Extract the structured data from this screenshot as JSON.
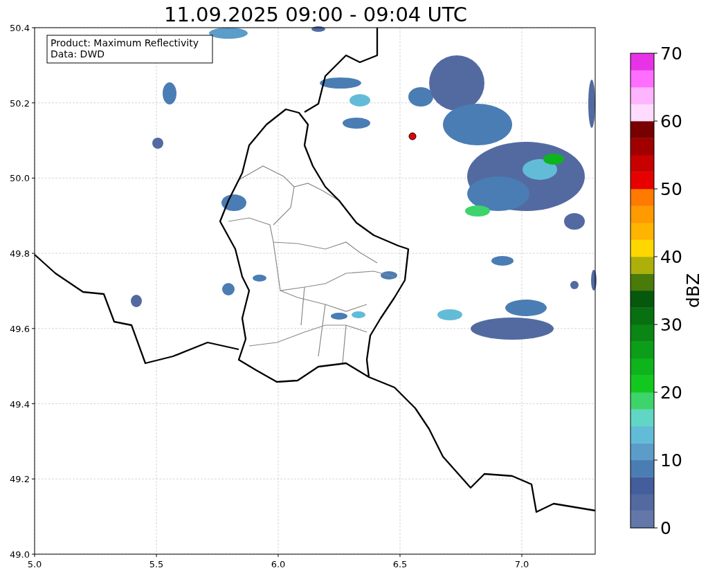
{
  "title": "11.09.2025 09:00 - 09:04 UTC",
  "info_box": [
    "Product: Maximum Reflectivity",
    "Data: DWD"
  ],
  "x_ticks": [
    "5.0",
    "5.5",
    "6.0",
    "6.5",
    "7.0"
  ],
  "y_ticks": [
    "50.4",
    "50.2",
    "50.0",
    "49.8",
    "49.6",
    "49.4",
    "49.2",
    "49.0"
  ],
  "colorbar": {
    "label": "dBZ",
    "ticks": [
      "70",
      "60",
      "50",
      "40",
      "30",
      "20",
      "10",
      "0"
    ],
    "segments": [
      {
        "color": "#6378a8"
      },
      {
        "color": "#536aa1"
      },
      {
        "color": "#435d9d"
      },
      {
        "color": "#4a7db3"
      },
      {
        "color": "#5b9cc9"
      },
      {
        "color": "#62bcd8"
      },
      {
        "color": "#62d6c4"
      },
      {
        "color": "#3dd46c"
      },
      {
        "color": "#12c81e"
      },
      {
        "color": "#0eb41c"
      },
      {
        "color": "#0c9e18"
      },
      {
        "color": "#0a8614"
      },
      {
        "color": "#087010"
      },
      {
        "color": "#06580c"
      },
      {
        "color": "#4a7a0a"
      },
      {
        "color": "#adb00a"
      },
      {
        "color": "#ffd700"
      },
      {
        "color": "#ffb400"
      },
      {
        "color": "#ff9a00"
      },
      {
        "color": "#ff7a00"
      },
      {
        "color": "#e60000"
      },
      {
        "color": "#c80000"
      },
      {
        "color": "#a00000"
      },
      {
        "color": "#780000"
      },
      {
        "color": "#ffdcff"
      },
      {
        "color": "#ffb4ff"
      },
      {
        "color": "#ff6eff"
      },
      {
        "color": "#e832e8"
      }
    ]
  }
}
